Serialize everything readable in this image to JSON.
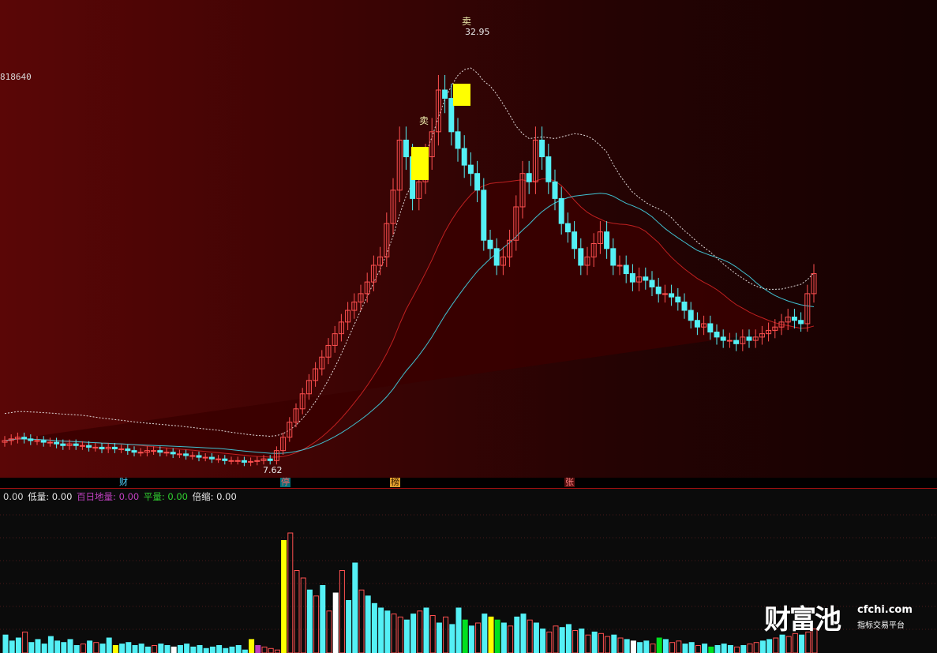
{
  "price_label": "818640",
  "signals": {
    "sell_high": "卖",
    "sell_mid": "卖"
  },
  "annotations": {
    "high": "32.95",
    "low": "7.62"
  },
  "events": {
    "cai": "财",
    "ting": "停",
    "bang": "榜",
    "zhang": "张"
  },
  "legend": {
    "lead": "0.00",
    "low": "低量: 0.00",
    "bai": "百日地量: 0.00",
    "ping": "平量: 0.00",
    "bei": "倍缩: 0.00"
  },
  "watermark": {
    "logo": "财富池",
    "site": "cfchi.com",
    "sub": "指标交易平台"
  },
  "colors": {
    "up": "#ff5050",
    "down": "#54f0f5",
    "signal": "#ffff00",
    "white_bar": "#ffffff",
    "green_bar": "#00e020",
    "red_bar": "#ff2020",
    "band_red": "#3a0000",
    "band_green": "#0a6a0a"
  },
  "chart_data": [
    {
      "type": "candlestick",
      "title": "",
      "ymax_label": "818640",
      "high_label": "32.95",
      "low_label": "7.62",
      "x": [
        1,
        2,
        3,
        4,
        5,
        6,
        7,
        8,
        9,
        10,
        11,
        12,
        13,
        14,
        15,
        16,
        17,
        18,
        19,
        20,
        21,
        22,
        23,
        24,
        25,
        26,
        27,
        28,
        29,
        30,
        31,
        32,
        33,
        34,
        35,
        36,
        37,
        38,
        39,
        40,
        41,
        42,
        43,
        44,
        45,
        46,
        47,
        48,
        49,
        50,
        51,
        52,
        53,
        54,
        55,
        56,
        57,
        58,
        59,
        60,
        61,
        62,
        63,
        64,
        65,
        66,
        67,
        68,
        69,
        70,
        71,
        72,
        73,
        74,
        75,
        76,
        77,
        78,
        79,
        80,
        81,
        82,
        83,
        84,
        85,
        86,
        87,
        88,
        89,
        90,
        91,
        92,
        93,
        94,
        95,
        96,
        97,
        98,
        99,
        100,
        101,
        102,
        103,
        104,
        105,
        106,
        107,
        108,
        109,
        110,
        111,
        112,
        113,
        114,
        115,
        116,
        117,
        118,
        119,
        120,
        121,
        122,
        123,
        124,
        125,
        126,
        127,
        128,
        129,
        130,
        131,
        132,
        133,
        134,
        135,
        136,
        137,
        138,
        139,
        140,
        141,
        142,
        143,
        144,
        145
      ],
      "open": [
        8.9,
        9.0,
        9.1,
        9.2,
        9.1,
        9.0,
        9.0,
        8.9,
        8.9,
        8.8,
        8.7,
        8.8,
        8.7,
        8.7,
        8.6,
        8.6,
        8.5,
        8.6,
        8.5,
        8.5,
        8.4,
        8.3,
        8.3,
        8.4,
        8.4,
        8.3,
        8.3,
        8.2,
        8.2,
        8.1,
        8.1,
        8.0,
        8.0,
        7.9,
        7.9,
        7.8,
        7.8,
        7.8,
        7.7,
        7.75,
        7.8,
        7.9,
        7.8,
        8.4,
        9.2,
        10.1,
        10.9,
        11.8,
        12.6,
        13.3,
        14.0,
        14.7,
        15.4,
        16.1,
        16.8,
        17.3,
        17.8,
        18.5,
        19.5,
        20.0,
        22.0,
        24.0,
        27.0,
        26.0,
        23.5,
        24.5,
        26.0,
        27.5,
        30.0,
        29.5,
        27.5,
        26.5,
        25.5,
        25.0,
        24.0,
        21.0,
        20.5,
        19.5,
        20.0,
        21.0,
        23.0,
        25.0,
        24.5,
        27.0,
        26.0,
        24.5,
        23.5,
        22.0,
        21.5,
        20.5,
        19.5,
        20.0,
        20.8,
        21.5,
        20.5,
        19.5,
        19.5,
        19.0,
        18.5,
        18.8,
        18.6,
        18.2,
        17.8,
        17.8,
        17.6,
        17.3,
        16.8,
        16.2,
        15.8,
        16.0,
        15.5,
        15.2,
        15.0,
        15.0,
        14.8,
        15.2,
        15.0,
        15.2,
        15.4,
        15.6,
        15.8,
        16.1,
        16.4,
        16.2,
        16.0,
        17.8
      ],
      "close": [
        9.0,
        9.1,
        9.2,
        9.1,
        9.0,
        9.0,
        8.9,
        8.9,
        8.8,
        8.7,
        8.8,
        8.7,
        8.7,
        8.6,
        8.6,
        8.5,
        8.6,
        8.5,
        8.5,
        8.4,
        8.3,
        8.3,
        8.4,
        8.4,
        8.3,
        8.3,
        8.2,
        8.2,
        8.1,
        8.1,
        8.0,
        8.0,
        7.9,
        7.9,
        7.8,
        7.8,
        7.8,
        7.7,
        7.75,
        7.8,
        7.9,
        7.8,
        8.4,
        9.2,
        10.1,
        10.9,
        11.8,
        12.6,
        13.3,
        14.0,
        14.7,
        15.4,
        16.1,
        16.8,
        17.3,
        17.8,
        18.5,
        19.5,
        20.0,
        22.0,
        24.0,
        27.0,
        26.0,
        23.5,
        24.5,
        26.0,
        27.5,
        30.0,
        29.5,
        27.5,
        26.5,
        25.5,
        25.0,
        24.0,
        21.0,
        20.5,
        19.5,
        20.0,
        21.0,
        23.0,
        25.0,
        24.5,
        27.0,
        26.0,
        24.5,
        23.5,
        22.0,
        21.5,
        20.5,
        19.5,
        20.0,
        20.8,
        21.5,
        20.5,
        19.5,
        19.5,
        19.0,
        18.5,
        18.8,
        18.6,
        18.2,
        17.8,
        17.8,
        17.6,
        17.3,
        16.8,
        16.2,
        15.8,
        16.0,
        15.5,
        15.2,
        15.0,
        15.0,
        14.8,
        15.2,
        15.0,
        15.2,
        15.4,
        15.6,
        15.8,
        16.1,
        16.4,
        16.2,
        16.0,
        17.8,
        19.0
      ]
    },
    {
      "type": "bar",
      "title": "",
      "legend": [
        "低量",
        "百日地量",
        "平量",
        "倍缩"
      ],
      "values": [
        0.12,
        0.08,
        0.1,
        0.14,
        0.07,
        0.09,
        0.06,
        0.11,
        0.08,
        0.07,
        0.09,
        0.05,
        0.06,
        0.08,
        0.07,
        0.06,
        0.1,
        0.05,
        0.06,
        0.07,
        0.05,
        0.06,
        0.04,
        0.05,
        0.06,
        0.05,
        0.04,
        0.05,
        0.06,
        0.04,
        0.05,
        0.03,
        0.04,
        0.05,
        0.03,
        0.04,
        0.05,
        0.02,
        0.09,
        0.05,
        0.04,
        0.03,
        0.02,
        0.75,
        0.8,
        0.55,
        0.5,
        0.42,
        0.38,
        0.45,
        0.28,
        0.4,
        0.55,
        0.35,
        0.6,
        0.42,
        0.38,
        0.33,
        0.3,
        0.28,
        0.26,
        0.24,
        0.22,
        0.26,
        0.28,
        0.3,
        0.25,
        0.2,
        0.24,
        0.19,
        0.3,
        0.22,
        0.18,
        0.2,
        0.26,
        0.24,
        0.22,
        0.2,
        0.18,
        0.24,
        0.26,
        0.22,
        0.2,
        0.16,
        0.14,
        0.18,
        0.17,
        0.19,
        0.15,
        0.16,
        0.12,
        0.14,
        0.13,
        0.11,
        0.12,
        0.1,
        0.09,
        0.08,
        0.07,
        0.08,
        0.06,
        0.1,
        0.09,
        0.07,
        0.08,
        0.06,
        0.07,
        0.05,
        0.06,
        0.04,
        0.05,
        0.06,
        0.05,
        0.04,
        0.05,
        0.06,
        0.07,
        0.08,
        0.09,
        0.1,
        0.12,
        0.11,
        0.13,
        0.12,
        0.14,
        0.16
      ],
      "kinds": [
        "c",
        "c",
        "c",
        "r",
        "c",
        "c",
        "c",
        "c",
        "c",
        "c",
        "c",
        "c",
        "r",
        "c",
        "r",
        "c",
        "c",
        "y",
        "c",
        "c",
        "c",
        "c",
        "c",
        "r",
        "c",
        "c",
        "w",
        "c",
        "c",
        "c",
        "c",
        "c",
        "c",
        "c",
        "c",
        "c",
        "c",
        "c",
        "y",
        "m",
        "r",
        "r",
        "r",
        "y",
        "r",
        "r",
        "r",
        "c",
        "r",
        "c",
        "r",
        "w",
        "r",
        "c",
        "c",
        "r",
        "c",
        "c",
        "c",
        "c",
        "r",
        "r",
        "c",
        "c",
        "r",
        "c",
        "r",
        "c",
        "r",
        "c",
        "c",
        "g",
        "c",
        "r",
        "c",
        "y",
        "g",
        "c",
        "r",
        "c",
        "c",
        "r",
        "c",
        "c",
        "r",
        "r",
        "c",
        "c",
        "r",
        "c",
        "r",
        "c",
        "r",
        "r",
        "c",
        "r",
        "c",
        "w",
        "c",
        "c",
        "r",
        "g",
        "c",
        "r",
        "r",
        "c",
        "c",
        "r",
        "c",
        "g",
        "c",
        "c",
        "c",
        "r",
        "c",
        "r",
        "r",
        "c",
        "c",
        "r",
        "c",
        "r",
        "r",
        "c",
        "r",
        "r",
        "c",
        "r",
        "r",
        "r"
      ]
    }
  ]
}
